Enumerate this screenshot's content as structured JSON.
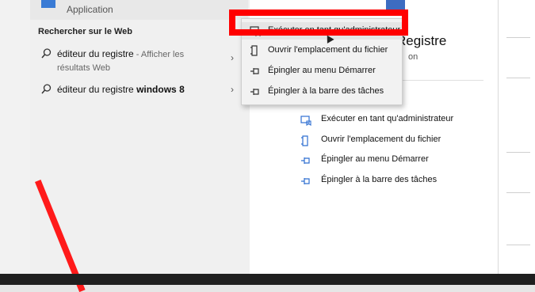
{
  "top_result": {
    "subtitle": "Application"
  },
  "web_section": {
    "title": "Rechercher sur le Web",
    "items": [
      {
        "main": "éditeur du registre",
        "suffix": " - Afficher les",
        "line2": "résultats Web"
      },
      {
        "main": "éditeur du registre ",
        "bold": "windows 8"
      }
    ]
  },
  "detail": {
    "title": "Registre",
    "subtitle": "on",
    "actions": [
      {
        "label": "Exécuter en tant qu'administrateur",
        "icon": "run-as-admin-icon"
      },
      {
        "label": "Ouvrir l'emplacement du fichier",
        "icon": "file-location-icon"
      },
      {
        "label": "Épingler au menu Démarrer",
        "icon": "pin-icon"
      },
      {
        "label": "Épingler à la barre des tâches",
        "icon": "pin-icon"
      }
    ]
  },
  "context_menu": {
    "items": [
      {
        "label": "Exécuter en tant qu'administrateur",
        "icon": "run-as-admin-icon",
        "highlighted": true
      },
      {
        "label": "Ouvrir l'emplacement du fichier",
        "icon": "file-location-icon"
      },
      {
        "label": "Épingler au menu Démarrer",
        "icon": "pin-icon"
      },
      {
        "label": "Épingler à la barre des tâches",
        "icon": "pin-icon"
      }
    ]
  },
  "colors": {
    "highlight_annotation": "#ff0000",
    "accent_blue": "#2f6fd1"
  }
}
